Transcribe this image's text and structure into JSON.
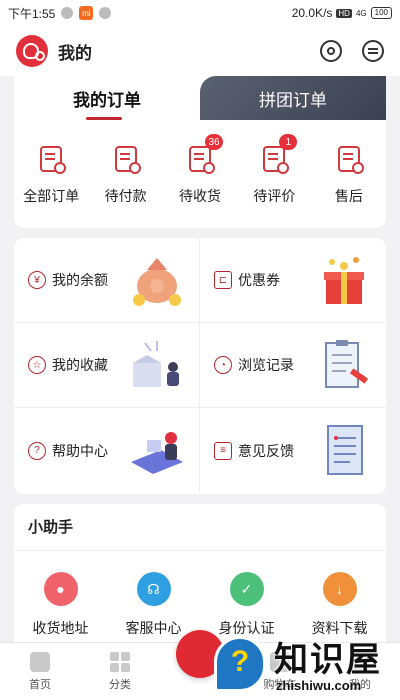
{
  "status_bar": {
    "time": "下午1:55",
    "mi": "mi",
    "speed": "20.0K/s",
    "hd": "HD",
    "signal": "4G",
    "battery": "100"
  },
  "header": {
    "title": "我的"
  },
  "order_tabs": {
    "active": "我的订单",
    "inactive": "拼团订单"
  },
  "orders": [
    {
      "label": "全部订单",
      "badge": ""
    },
    {
      "label": "待付款",
      "badge": ""
    },
    {
      "label": "待收货",
      "badge": "36"
    },
    {
      "label": "待评价",
      "badge": "1"
    },
    {
      "label": "售后",
      "badge": ""
    }
  ],
  "grid": [
    {
      "label": "我的余额",
      "icon": "money-bag-icon"
    },
    {
      "label": "优惠券",
      "icon": "coupon-icon"
    },
    {
      "label": "我的收藏",
      "icon": "star-icon"
    },
    {
      "label": "浏览记录",
      "icon": "history-icon"
    },
    {
      "label": "帮助中心",
      "icon": "help-icon"
    },
    {
      "label": "意见反馈",
      "icon": "feedback-icon"
    }
  ],
  "assistant": {
    "title": "小助手",
    "items": [
      {
        "label": "收货地址",
        "color": "#f0636a"
      },
      {
        "label": "客服中心",
        "color": "#2e9fe0"
      },
      {
        "label": "身份认证",
        "color": "#4cc07a"
      },
      {
        "label": "资料下载",
        "color": "#f0903a"
      }
    ]
  },
  "bottom_nav": [
    {
      "label": "首页"
    },
    {
      "label": "分类"
    },
    {
      "label": ""
    },
    {
      "label": "购物车"
    },
    {
      "label": "我的"
    }
  ],
  "watermark": {
    "text": "知识屋",
    "sub": "zhishiwu.com",
    "registered": "®"
  },
  "colors": {
    "brand": "#e0303c",
    "accent": "#c0282f"
  }
}
